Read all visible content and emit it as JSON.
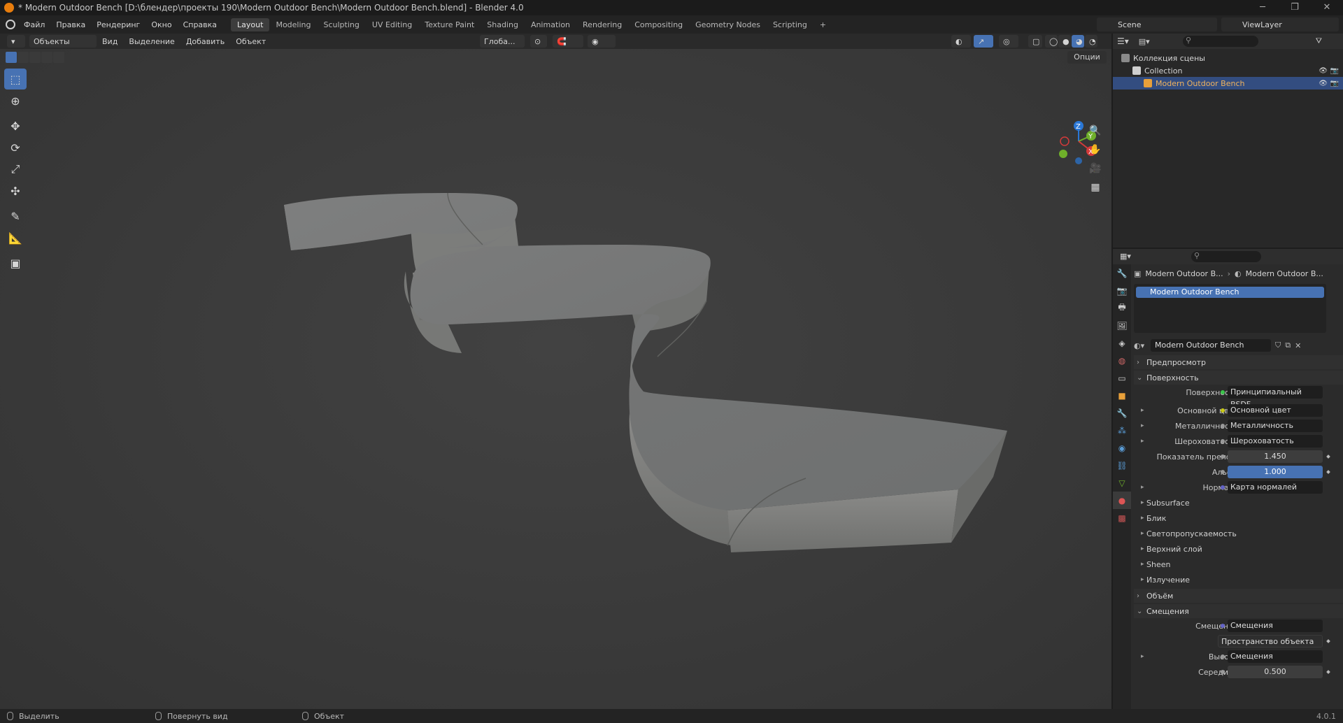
{
  "window": {
    "title": "* Modern Outdoor Bench [D:\\блендер\\проекты 190\\Modern Outdoor Bench\\Modern Outdoor Bench.blend] - Blender 4.0",
    "controls": [
      "─",
      "❐",
      "✕"
    ]
  },
  "menu": {
    "items": [
      "Файл",
      "Правка",
      "Рендеринг",
      "Окно",
      "Справка"
    ]
  },
  "workspaces": {
    "tabs": [
      "Layout",
      "Modeling",
      "Sculpting",
      "UV Editing",
      "Texture Paint",
      "Shading",
      "Animation",
      "Rendering",
      "Compositing",
      "Geometry Nodes",
      "Scripting"
    ],
    "active": "Layout",
    "add": "+"
  },
  "scene": {
    "name": "Scene",
    "view_layer": "ViewLayer"
  },
  "viewport_header": {
    "mode": "Объекты",
    "menus": [
      "Вид",
      "Выделение",
      "Добавить",
      "Объект"
    ],
    "transform_orientation": "Глоба...",
    "options": "Опции"
  },
  "gizmo": {
    "z": "Z",
    "y": "Y",
    "x": "X"
  },
  "toolbar": {
    "tools": [
      {
        "icon": "select-box-icon",
        "glyph": "⬚",
        "active": true
      },
      {
        "icon": "cursor-icon",
        "glyph": "⊕",
        "active": false
      },
      {
        "icon": "move-icon",
        "glyph": "✥",
        "active": false
      },
      {
        "icon": "rotate-icon",
        "glyph": "⟳",
        "active": false
      },
      {
        "icon": "scale-icon",
        "glyph": "⤢",
        "active": false
      },
      {
        "icon": "transform-icon",
        "glyph": "✣",
        "active": false
      },
      {
        "icon": "annotate-icon",
        "glyph": "✎",
        "active": false
      },
      {
        "icon": "measure-icon",
        "glyph": "📐",
        "active": false
      },
      {
        "icon": "add-cube-icon",
        "glyph": "▣",
        "active": false
      }
    ]
  },
  "outliner": {
    "rows": [
      {
        "label": "Коллекция сцены",
        "indent": 0,
        "selected": false
      },
      {
        "label": "Collection",
        "indent": 1,
        "selected": false
      },
      {
        "label": "Modern Outdoor Bench",
        "indent": 2,
        "selected": true
      }
    ]
  },
  "properties": {
    "breadcrumb_object": "Modern Outdoor B...",
    "breadcrumb_material": "Modern Outdoor B...",
    "slot": "Modern Outdoor Bench",
    "material_name": "Modern Outdoor Bench",
    "panels": {
      "preview": "Предпросмотр",
      "surface": "Поверхность",
      "volume": "Объём",
      "displacement": "Смещения"
    },
    "surface_rows": [
      {
        "label": "Поверхность",
        "value": "Принципиальный BSDF",
        "kind": "field",
        "tri": false,
        "dot": "green"
      },
      {
        "label": "Основной цвет",
        "value": "Основной цвет",
        "kind": "field",
        "tri": true,
        "dot": "yellow"
      },
      {
        "label": "Металличность",
        "value": "Металличность",
        "kind": "field",
        "tri": true,
        "dot": "gray"
      },
      {
        "label": "Шероховатость",
        "value": "Шероховатость",
        "kind": "field",
        "tri": true,
        "dot": "gray"
      },
      {
        "label": "Показатель прело...",
        "value": "1.450",
        "kind": "num",
        "tri": false,
        "dot": "gray"
      },
      {
        "label": "Альфа",
        "value": "1.000",
        "kind": "numblue",
        "tri": false,
        "dot": "gray"
      },
      {
        "label": "Нормаль",
        "value": "Карта нормалей",
        "kind": "field",
        "tri": true,
        "dot": "blue"
      }
    ],
    "subpanels": [
      "Subsurface",
      "Блик",
      "Светопропускаемость",
      "Верхний слой",
      "Sheen",
      "Излучение"
    ],
    "displacement_rows": [
      {
        "label": "Смещения",
        "value": "Смещения",
        "kind": "field",
        "tri": false,
        "dot": "blue"
      },
      {
        "label": "",
        "value": "Пространство объекта",
        "kind": "select",
        "tri": false,
        "dot": ""
      },
      {
        "label": "Высота",
        "value": "Смещения",
        "kind": "field",
        "tri": true,
        "dot": "gray"
      },
      {
        "label": "Середина",
        "value": "0.500",
        "kind": "num",
        "tri": false,
        "dot": "gray"
      }
    ]
  },
  "statusbar": {
    "select": "Выделить",
    "rotate": "Повернуть вид",
    "object": "Объект",
    "version": "4.0.1"
  },
  "colors": {
    "accent": "#4772b3",
    "orange": "#e87d0d",
    "selected_row": "#334d80"
  }
}
